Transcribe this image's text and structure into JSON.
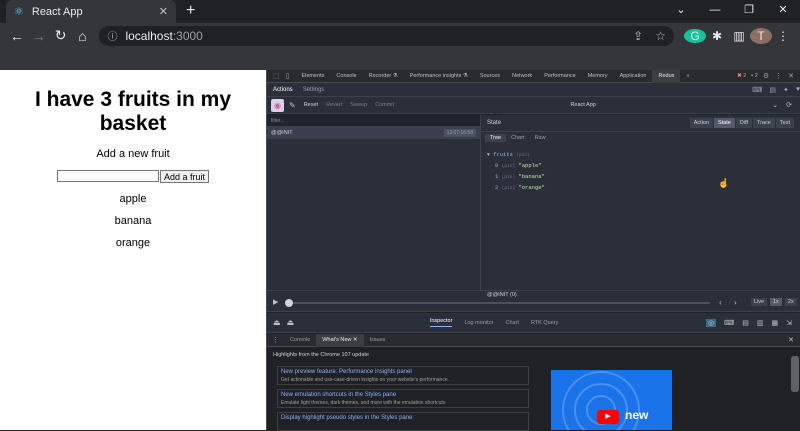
{
  "browser": {
    "tab_title": "React App",
    "tab_close": "✕",
    "new_tab": "+",
    "url_host": "localhost",
    "url_port": ":3000",
    "profile_initial": "T",
    "grammarly": "G"
  },
  "page": {
    "heading": "I have 3 fruits in my basket",
    "add_label": "Add a new fruit",
    "input_value": "",
    "add_button": "Add a fruit",
    "fruits": [
      "apple",
      "banana",
      "orange"
    ]
  },
  "devtools": {
    "tabs": [
      "Elements",
      "Console",
      "Recorder ⚗",
      "Performance insights ⚗",
      "Sources",
      "Network",
      "Performance",
      "Memory",
      "Application",
      "Redux"
    ],
    "active_tab": "Redux",
    "more": "»",
    "errors": "2",
    "messages": "2"
  },
  "redux": {
    "header_tabs": [
      "Actions",
      "Settings"
    ],
    "toolbar_buttons": [
      "Reset",
      "Revert",
      "Sweep",
      "Commit"
    ],
    "instance": "React App",
    "filter_placeholder": "filter...",
    "action_name": "@@INIT",
    "action_time": "12:07:16.58",
    "state_label": "State",
    "monitor_tabs": [
      "Action",
      "State",
      "Diff",
      "Trace",
      "Test"
    ],
    "view_tabs": [
      "Tree",
      "Chart",
      "Raw"
    ],
    "tree": {
      "key": "fruits",
      "type": "(pin)",
      "items": [
        {
          "index": "0",
          "type": "(pin)",
          "value": "\"apple\""
        },
        {
          "index": "1",
          "type": "(pin)",
          "value": "\"banana\""
        },
        {
          "index": "2",
          "type": "(pin)",
          "value": "\"orange\""
        }
      ]
    },
    "slider_label": "@@INIT (0)",
    "speed_buttons": [
      "Live",
      "1x",
      "2x"
    ],
    "bottom_tabs": [
      "Inspector",
      "Log monitor",
      "Chart",
      "RTK Query"
    ]
  },
  "drawer": {
    "tabs": [
      "Console",
      "What's New",
      "Issues"
    ],
    "heading": "Highlights from the Chrome 107 update",
    "cards": [
      {
        "title": "New preview feature: Performance insights panel",
        "desc": "Get actionable and use-case-driven insights on your website's performance."
      },
      {
        "title": "New emulation shortcuts in the Styles pane",
        "desc": "Emulate light themes, dark themes, and more with the emulation shortcuts."
      },
      {
        "title": "Display highlight pseudo styles in the Styles pane",
        "desc": ""
      }
    ],
    "video_badge": "new"
  }
}
